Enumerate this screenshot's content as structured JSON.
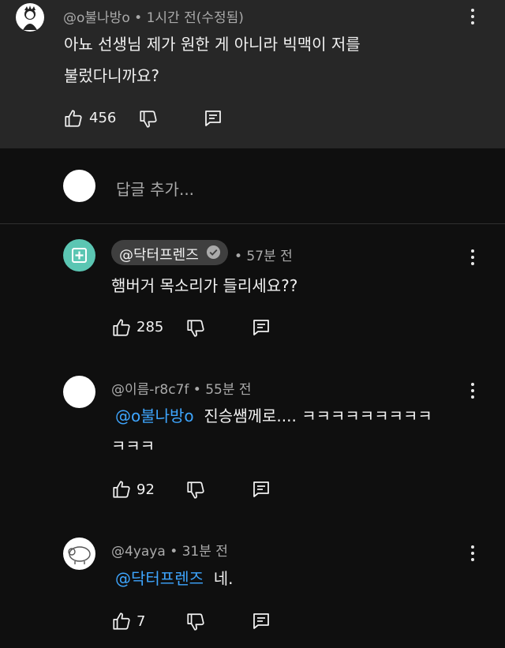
{
  "parent_comment": {
    "author": "@o불나방o",
    "time": "• 1시간 전(수정됨)",
    "text_line1": "아뇨 선생님 제가 원한 게 아니라 빅맥이 저를",
    "text_line2": "불렀다니까요?",
    "likes": "456"
  },
  "reply_box": {
    "placeholder": "답글 추가..."
  },
  "replies": [
    {
      "author": "@닥터프렌즈",
      "time": "• 57분 전",
      "text": "햄버거 목소리가 들리세요??",
      "likes": "285"
    },
    {
      "author": "@이름-r8c7f",
      "time": "• 55분 전",
      "mention": "@o불나방o",
      "text_line1": "진승쌤께로.... ㅋㅋㅋㅋㅋㅋㅋㅋㅋ",
      "text_line2": "ㅋㅋㅋ",
      "likes": "92"
    },
    {
      "author": "@4yaya",
      "time": "• 31분 전",
      "mention": "@닥터프렌즈",
      "text": "네.",
      "likes": "7"
    }
  ],
  "colors": {
    "mention": "#3ea6ff",
    "verified": "#aaaaaa",
    "channel_avatar": "#5bc6b3"
  },
  "icons": [
    "like-icon",
    "dislike-icon",
    "reply-icon",
    "more-icon",
    "verified-icon",
    "hospital-icon"
  ]
}
